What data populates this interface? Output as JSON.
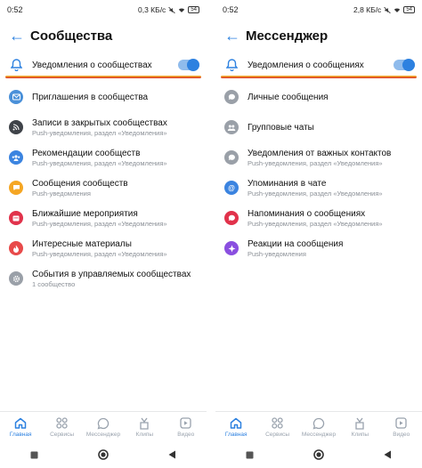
{
  "colors": {
    "accent": "#2d81e0",
    "toggle_track": "#8fbbec",
    "underline_top": "#f6c533",
    "underline_bottom": "#d62a22"
  },
  "left": {
    "status": {
      "time": "0:52",
      "speed": "0,3 КБ/с",
      "battery": "54"
    },
    "title": "Сообщества",
    "main_toggle": {
      "label": "Уведомления о сообществах",
      "on": true
    },
    "items": [
      {
        "label": "Приглашения в сообщества",
        "sub": "",
        "color": "#4a90d9",
        "icon": "invite-icon"
      },
      {
        "label": "Записи в закрытых сообществах",
        "sub": "Push-уведомления, раздел «Уведомления»",
        "color": "#3f4349",
        "icon": "rss-icon"
      },
      {
        "label": "Рекомендации сообществ",
        "sub": "Push-уведомления, раздел «Уведомления»",
        "color": "#3b84e0",
        "icon": "users-icon"
      },
      {
        "label": "Сообщения сообществ",
        "sub": "Push-уведомления",
        "color": "#f5a623",
        "icon": "message-icon"
      },
      {
        "label": "Ближайшие мероприятия",
        "sub": "Push-уведомления, раздел «Уведомления»",
        "color": "#e1324b",
        "icon": "calendar-icon"
      },
      {
        "label": "Интересные материалы",
        "sub": "Push-уведомления, раздел «Уведомления»",
        "color": "#e84a4a",
        "icon": "fire-icon"
      },
      {
        "label": "События в управляемых сообществах",
        "sub": "1 сообщество",
        "color": "#9aa0a8",
        "icon": "gear-icon"
      }
    ]
  },
  "right": {
    "status": {
      "time": "0:52",
      "speed": "2,8 КБ/с",
      "battery": "54"
    },
    "title": "Мессенджер",
    "main_toggle": {
      "label": "Уведомления о сообщениях",
      "on": true
    },
    "items": [
      {
        "label": "Личные сообщения",
        "sub": "",
        "color": "#9aa0a8",
        "icon": "chat-icon"
      },
      {
        "label": "Групповые чаты",
        "sub": "",
        "color": "#9aa0a8",
        "icon": "group-chat-icon"
      },
      {
        "label": "Уведомления от важных контактов",
        "sub": "Push-уведомления, раздел «Уведомления»",
        "color": "#9aa0a8",
        "icon": "important-icon"
      },
      {
        "label": "Упоминания в чате",
        "sub": "Push-уведомления, раздел «Уведомления»",
        "color": "#3b84e0",
        "icon": "mention-icon"
      },
      {
        "label": "Напоминания о сообщениях",
        "sub": "Push-уведомления, раздел «Уведомления»",
        "color": "#e1324b",
        "icon": "reminder-icon"
      },
      {
        "label": "Реакции на сообщения",
        "sub": "Push-уведомления",
        "color": "#8a4fe0",
        "icon": "reaction-icon"
      }
    ]
  },
  "tabs": [
    {
      "label": "Главная",
      "icon": "home-icon",
      "active": true
    },
    {
      "label": "Сервисы",
      "icon": "services-icon",
      "active": false
    },
    {
      "label": "Мессенджер",
      "icon": "messenger-icon",
      "active": false
    },
    {
      "label": "Клипы",
      "icon": "clips-icon",
      "active": false
    },
    {
      "label": "Видео",
      "icon": "video-icon",
      "active": false
    }
  ]
}
